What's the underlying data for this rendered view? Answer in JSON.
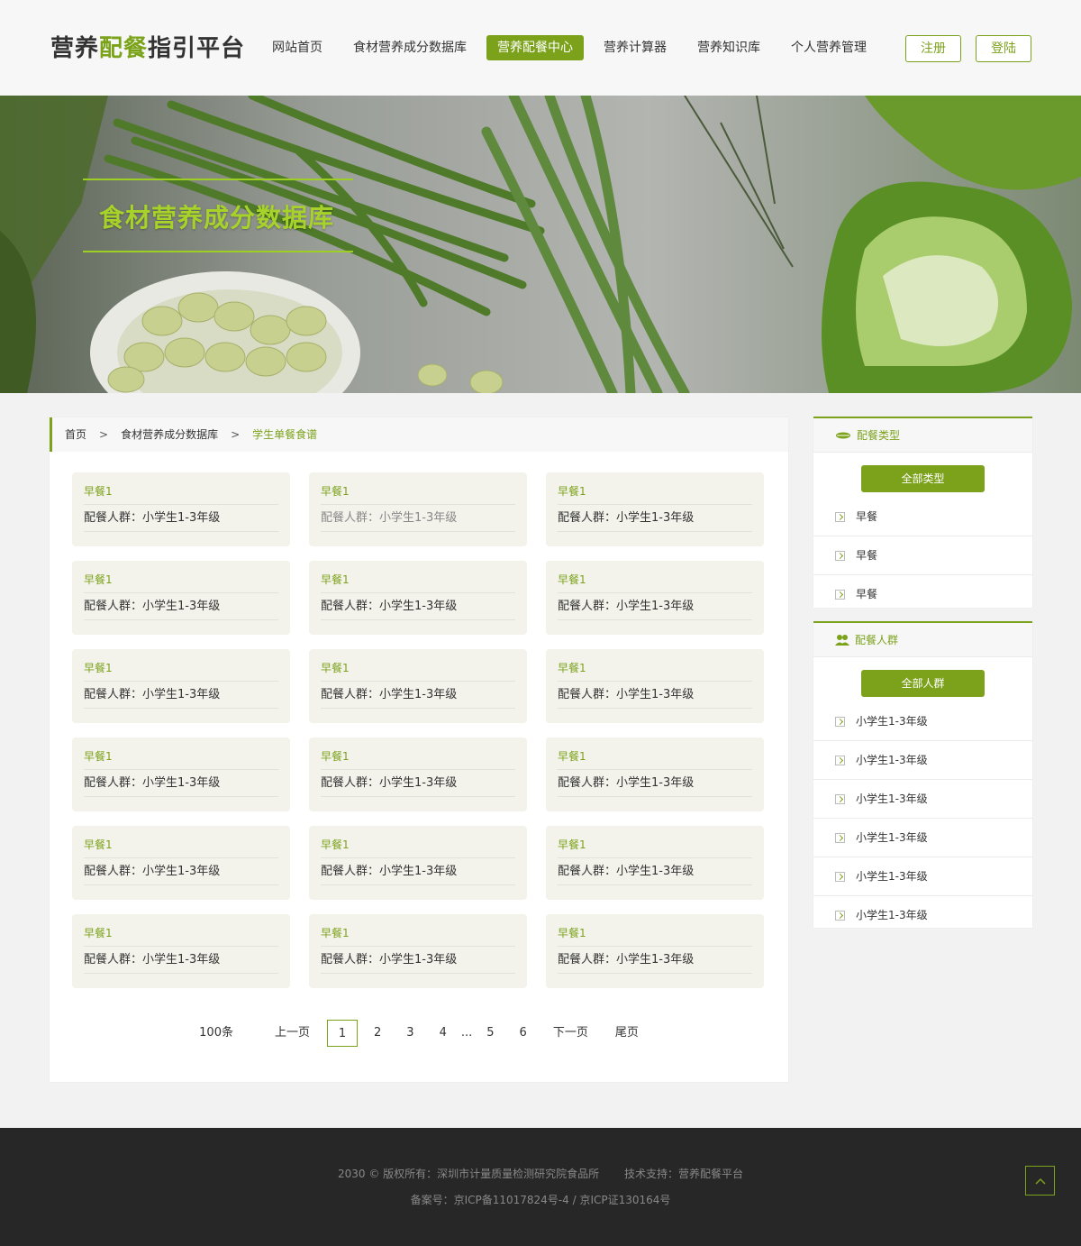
{
  "header": {
    "logo_pre": "营养",
    "logo_accent": "配餐",
    "logo_post": "指引平台",
    "nav": [
      {
        "label": "网站首页"
      },
      {
        "label": "食材营养成分数据库"
      },
      {
        "label": "营养配餐中心"
      },
      {
        "label": "营养计算器"
      },
      {
        "label": "营养知识库"
      },
      {
        "label": "个人营养管理"
      }
    ],
    "active_nav": "营养配餐中心",
    "register_label": "注册",
    "login_label": "登陆"
  },
  "banner": {
    "title": "食材营养成分数据库"
  },
  "breadcrumb": {
    "home": "首页",
    "sep": ">",
    "level1": "食材营养成分数据库",
    "current": "学生单餐食谱"
  },
  "cards": [
    {
      "title": "早餐1",
      "desc": "配餐人群：小学生1-3年级"
    },
    {
      "title": "早餐1",
      "desc": "配餐人群：小学生1-3年级"
    },
    {
      "title": "早餐1",
      "desc": "配餐人群：小学生1-3年级"
    },
    {
      "title": "早餐1",
      "desc": "配餐人群：小学生1-3年级"
    },
    {
      "title": "早餐1",
      "desc": "配餐人群：小学生1-3年级"
    },
    {
      "title": "早餐1",
      "desc": "配餐人群：小学生1-3年级"
    },
    {
      "title": "早餐1",
      "desc": "配餐人群：小学生1-3年级"
    },
    {
      "title": "早餐1",
      "desc": "配餐人群：小学生1-3年级"
    },
    {
      "title": "早餐1",
      "desc": "配餐人群：小学生1-3年级"
    },
    {
      "title": "早餐1",
      "desc": "配餐人群：小学生1-3年级"
    },
    {
      "title": "早餐1",
      "desc": "配餐人群：小学生1-3年级"
    },
    {
      "title": "早餐1",
      "desc": "配餐人群：小学生1-3年级"
    },
    {
      "title": "早餐1",
      "desc": "配餐人群：小学生1-3年级"
    },
    {
      "title": "早餐1",
      "desc": "配餐人群：小学生1-3年级"
    },
    {
      "title": "早餐1",
      "desc": "配餐人群：小学生1-3年级"
    },
    {
      "title": "早餐1",
      "desc": "配餐人群：小学生1-3年级"
    },
    {
      "title": "早餐1",
      "desc": "配餐人群：小学生1-3年级"
    },
    {
      "title": "早餐1",
      "desc": "配餐人群：小学生1-3年级"
    }
  ],
  "pagination": {
    "total": "100条",
    "prev": "上一页",
    "pages": [
      "1",
      "2",
      "3",
      "4",
      "...",
      "5",
      "6"
    ],
    "current": "1",
    "next": "下一页",
    "last": "尾页"
  },
  "sidebar": {
    "type_panel": {
      "title": "配餐类型",
      "all_label": "全部类型",
      "items": [
        "早餐",
        "早餐",
        "早餐"
      ]
    },
    "crowd_panel": {
      "title": "配餐人群",
      "all_label": "全部人群",
      "items": [
        "小学生1-3年级",
        "小学生1-3年级",
        "小学生1-3年级",
        "小学生1-3年级",
        "小学生1-3年级",
        "小学生1-3年级"
      ]
    }
  },
  "footer": {
    "copyright": "2030 © 版权所有：深圳市计量质量检测研究院食品所",
    "support": "技术支持：营养配餐平台",
    "icp": "备案号：京ICP备11017824号-4 / 京ICP证130164号"
  },
  "colors": {
    "accent": "#7ca21c",
    "banner_title": "#a6d22a",
    "footer_bg": "#272727"
  }
}
